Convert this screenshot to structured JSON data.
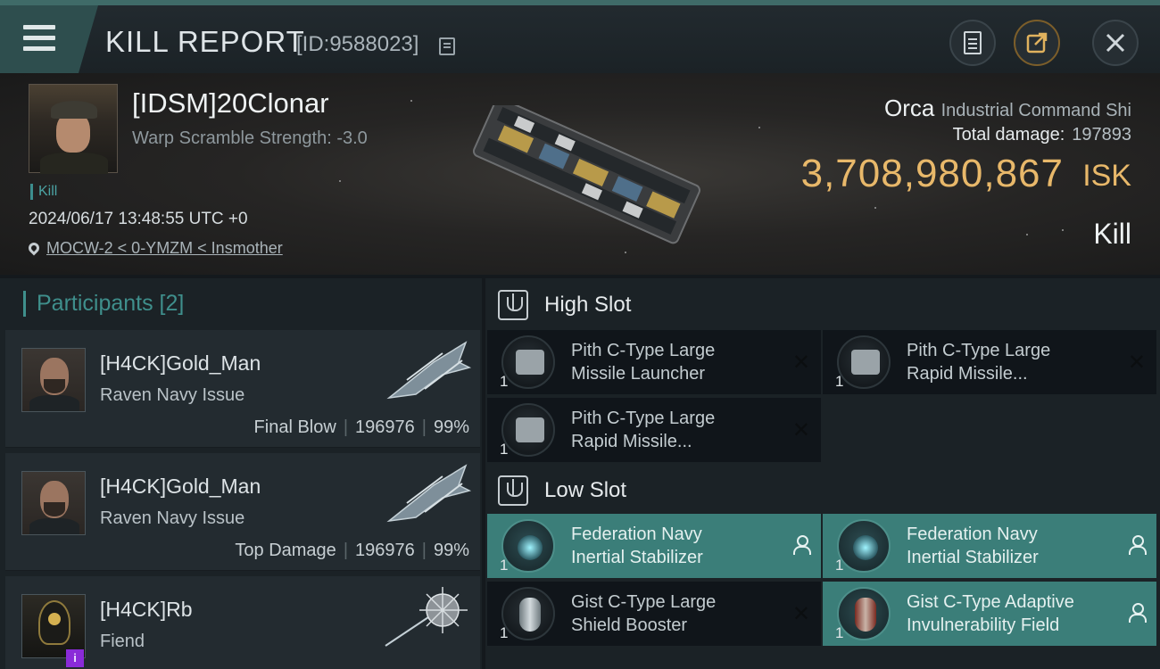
{
  "header": {
    "title": "KILL REPORT",
    "report_id": "[ID:9588023]"
  },
  "victim": {
    "name": "[IDSM]20Clonar",
    "warp_scramble": "Warp Scramble Strength: -3.0",
    "kill_tag": "Kill",
    "datetime": "2024/06/17 13:48:55 UTC +0",
    "location": "MOCW-2 < 0-YMZM < Insmother",
    "ship_name": "Orca",
    "ship_class": "Industrial Command Shi",
    "total_damage_label": "Total damage:",
    "total_damage": "197893",
    "isk_value": "3,708,980,867",
    "isk_unit": "ISK",
    "result": "Kill"
  },
  "participants": {
    "heading": "Participants [2]",
    "items": [
      {
        "name": "[H4CK]Gold_Man",
        "ship": "Raven Navy Issue",
        "role": "Final Blow",
        "damage": "196976",
        "percent": "99%"
      },
      {
        "name": "[H4CK]Gold_Man",
        "ship": "Raven Navy Issue",
        "role": "Top Damage",
        "damage": "196976",
        "percent": "99%"
      },
      {
        "name": "[H4CK]Rb",
        "ship": "Fiend",
        "badge": "i"
      }
    ]
  },
  "slots": {
    "high": {
      "label": "High Slot",
      "items": [
        {
          "qty": "1",
          "line1": "Pith C-Type Large",
          "line2": "Missile Launcher",
          "dropped": false
        },
        {
          "qty": "1",
          "line1": "Pith C-Type Large",
          "line2": "Rapid Missile...",
          "dropped": false
        },
        {
          "qty": "1",
          "line1": "Pith C-Type Large",
          "line2": "Rapid Missile...",
          "dropped": false
        }
      ]
    },
    "low": {
      "label": "Low Slot",
      "items": [
        {
          "qty": "1",
          "line1": "Federation Navy",
          "line2": "Inertial Stabilizer",
          "dropped": true
        },
        {
          "qty": "1",
          "line1": "Federation Navy",
          "line2": "Inertial Stabilizer",
          "dropped": true
        },
        {
          "qty": "1",
          "line1": "Gist C-Type Large",
          "line2": "Shield Booster",
          "dropped": false
        },
        {
          "qty": "1",
          "line1": "Gist C-Type Adaptive",
          "line2": "Invulnerability Field",
          "dropped": true
        }
      ]
    }
  },
  "icons": {
    "menu": "menu-icon",
    "copy": "copy-icon",
    "clipboard": "clipboard-icon",
    "share": "share-icon",
    "close": "close-icon",
    "pin": "location-pin-icon",
    "slot": "slot-icon",
    "destroyed": "x-icon",
    "dropped": "person-icon"
  },
  "colors": {
    "accent": "#3f8f8c",
    "isk": "#e8b86a",
    "highlight": "#3b7e79",
    "badge": "#8a2bd8"
  }
}
